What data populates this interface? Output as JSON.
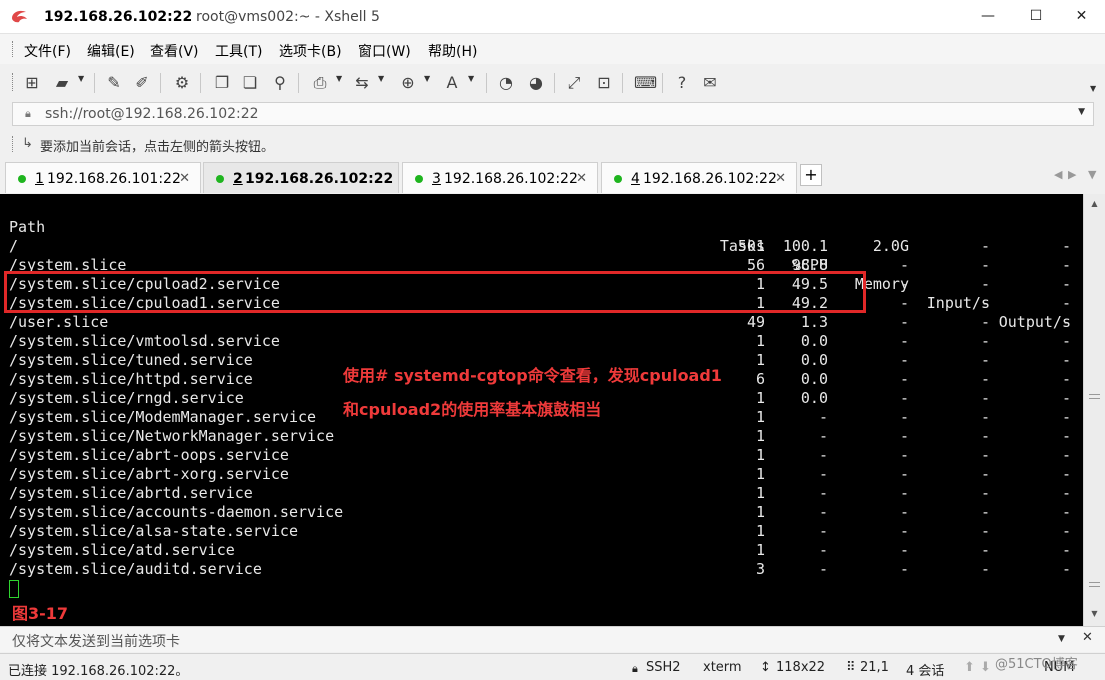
{
  "window": {
    "title_host": "192.168.26.102:22",
    "title_rest": "root@vms002:~ - Xshell 5",
    "minimize": "—",
    "maximize": "☐",
    "close": "✕"
  },
  "menu": [
    "文件(F)",
    "编辑(E)",
    "查看(V)",
    "工具(T)",
    "选项卡(B)",
    "窗口(W)",
    "帮助(H)"
  ],
  "address": {
    "value": "ssh://root@192.168.26.102:22",
    "hint": "要添加当前会话，点击左侧的箭头按钮。"
  },
  "tabs": [
    {
      "num": "1",
      "label": "192.168.26.101:22",
      "active": false
    },
    {
      "num": "2",
      "label": "192.168.26.102:22",
      "active": true
    },
    {
      "num": "3",
      "label": "192.168.26.102:22",
      "active": false
    },
    {
      "num": "4",
      "label": "192.168.26.102:22",
      "active": false
    }
  ],
  "terminal": {
    "headers": {
      "path": "Path",
      "tasks": "Tasks",
      "cpu": "%CPU",
      "memory": "Memory",
      "input": "Input/s",
      "output": "Output/s"
    },
    "rows": [
      {
        "path": "/",
        "tasks": "501",
        "cpu": "100.1",
        "mem": "2.0G",
        "in": "-",
        "out": "-"
      },
      {
        "path": "/system.slice",
        "tasks": "56",
        "cpu": "98.8",
        "mem": "-",
        "in": "-",
        "out": "-"
      },
      {
        "path": "/system.slice/cpuload2.service",
        "tasks": "1",
        "cpu": "49.5",
        "mem": "-",
        "in": "-",
        "out": "-"
      },
      {
        "path": "/system.slice/cpuload1.service",
        "tasks": "1",
        "cpu": "49.2",
        "mem": "-",
        "in": "-",
        "out": "-"
      },
      {
        "path": "/user.slice",
        "tasks": "49",
        "cpu": "1.3",
        "mem": "-",
        "in": "-",
        "out": "-"
      },
      {
        "path": "/system.slice/vmtoolsd.service",
        "tasks": "1",
        "cpu": "0.0",
        "mem": "-",
        "in": "-",
        "out": "-"
      },
      {
        "path": "/system.slice/tuned.service",
        "tasks": "1",
        "cpu": "0.0",
        "mem": "-",
        "in": "-",
        "out": "-"
      },
      {
        "path": "/system.slice/httpd.service",
        "tasks": "6",
        "cpu": "0.0",
        "mem": "-",
        "in": "-",
        "out": "-"
      },
      {
        "path": "/system.slice/rngd.service",
        "tasks": "1",
        "cpu": "0.0",
        "mem": "-",
        "in": "-",
        "out": "-"
      },
      {
        "path": "/system.slice/ModemManager.service",
        "tasks": "1",
        "cpu": "-",
        "mem": "-",
        "in": "-",
        "out": "-"
      },
      {
        "path": "/system.slice/NetworkManager.service",
        "tasks": "1",
        "cpu": "-",
        "mem": "-",
        "in": "-",
        "out": "-"
      },
      {
        "path": "/system.slice/abrt-oops.service",
        "tasks": "1",
        "cpu": "-",
        "mem": "-",
        "in": "-",
        "out": "-"
      },
      {
        "path": "/system.slice/abrt-xorg.service",
        "tasks": "1",
        "cpu": "-",
        "mem": "-",
        "in": "-",
        "out": "-"
      },
      {
        "path": "/system.slice/abrtd.service",
        "tasks": "1",
        "cpu": "-",
        "mem": "-",
        "in": "-",
        "out": "-"
      },
      {
        "path": "/system.slice/accounts-daemon.service",
        "tasks": "1",
        "cpu": "-",
        "mem": "-",
        "in": "-",
        "out": "-"
      },
      {
        "path": "/system.slice/alsa-state.service",
        "tasks": "1",
        "cpu": "-",
        "mem": "-",
        "in": "-",
        "out": "-"
      },
      {
        "path": "/system.slice/atd.service",
        "tasks": "1",
        "cpu": "-",
        "mem": "-",
        "in": "-",
        "out": "-"
      },
      {
        "path": "/system.slice/auditd.service",
        "tasks": "3",
        "cpu": "-",
        "mem": "-",
        "in": "-",
        "out": "-"
      }
    ],
    "annotation_line1": "使用# systemd-cgtop命令查看，发现cpuload1",
    "annotation_line2": "和cpuload2的使用率基本旗鼓相当",
    "figure_label": "图3-17"
  },
  "send_bar": {
    "placeholder": "仅将文本发送到当前选项卡"
  },
  "status": {
    "connection": "已连接 192.168.26.102:22。",
    "protocol": "SSH2",
    "term": "xterm",
    "size": "118x22",
    "position": "21,1",
    "sessions": "4 会话",
    "num": "NUM"
  },
  "watermark": "@51CTO博客",
  "colors": {
    "accent_red": "#e02828",
    "tab_dot": "#1fb51f",
    "terminal_bg": "#000000"
  }
}
